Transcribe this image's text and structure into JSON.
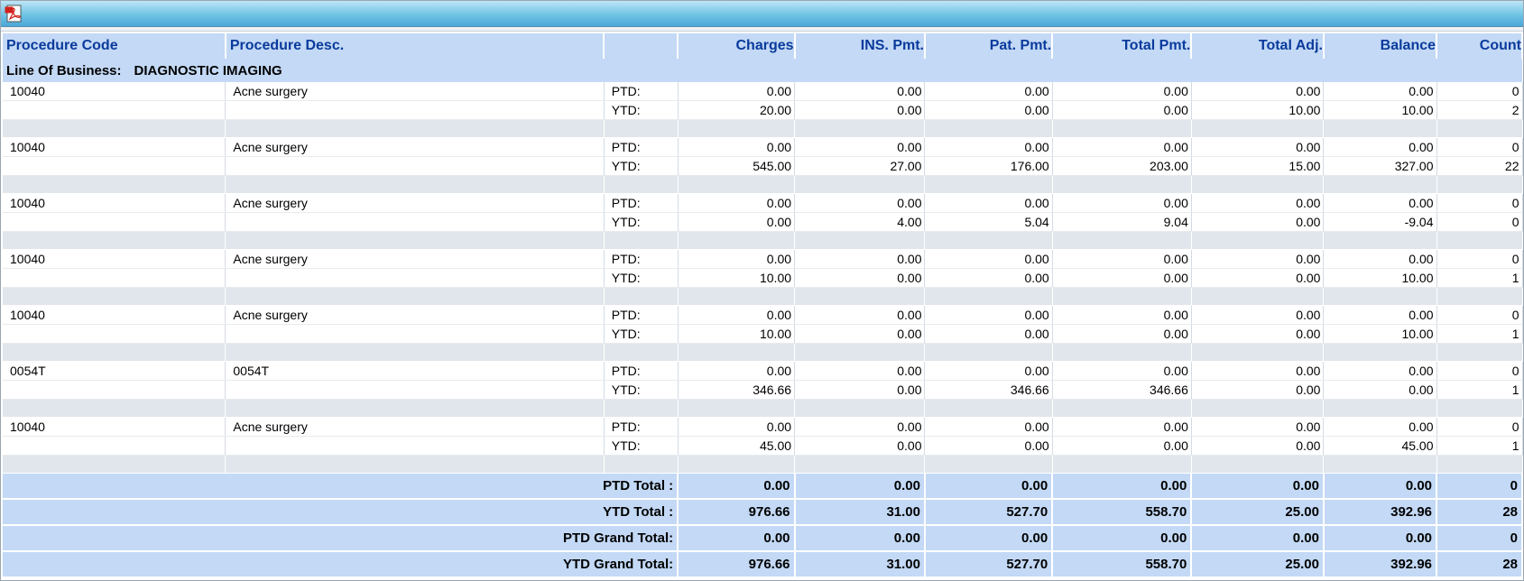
{
  "toolbar": {
    "pdf_icon": "pdf-icon"
  },
  "columns": [
    "Procedure Code",
    "Procedure Desc.",
    "",
    "Charges",
    "INS. Pmt.",
    "Pat. Pmt.",
    "Total Pmt.",
    "Total Adj.",
    "Balance",
    "Count"
  ],
  "line_of_business": {
    "label": "Line Of Business:",
    "value": "DIAGNOSTIC IMAGING"
  },
  "groups": [
    {
      "code": "10040",
      "desc": "Acne surgery",
      "ptd": {
        "label": "PTD:",
        "values": [
          "0.00",
          "0.00",
          "0.00",
          "0.00",
          "0.00",
          "0.00",
          "0"
        ]
      },
      "ytd": {
        "label": "YTD:",
        "values": [
          "20.00",
          "0.00",
          "0.00",
          "0.00",
          "10.00",
          "10.00",
          "2"
        ]
      }
    },
    {
      "code": "10040",
      "desc": "Acne surgery",
      "ptd": {
        "label": "PTD:",
        "values": [
          "0.00",
          "0.00",
          "0.00",
          "0.00",
          "0.00",
          "0.00",
          "0"
        ]
      },
      "ytd": {
        "label": "YTD:",
        "values": [
          "545.00",
          "27.00",
          "176.00",
          "203.00",
          "15.00",
          "327.00",
          "22"
        ]
      }
    },
    {
      "code": "10040",
      "desc": "Acne surgery",
      "ptd": {
        "label": "PTD:",
        "values": [
          "0.00",
          "0.00",
          "0.00",
          "0.00",
          "0.00",
          "0.00",
          "0"
        ]
      },
      "ytd": {
        "label": "YTD:",
        "values": [
          "0.00",
          "4.00",
          "5.04",
          "9.04",
          "0.00",
          "-9.04",
          "0"
        ]
      }
    },
    {
      "code": "10040",
      "desc": "Acne surgery",
      "ptd": {
        "label": "PTD:",
        "values": [
          "0.00",
          "0.00",
          "0.00",
          "0.00",
          "0.00",
          "0.00",
          "0"
        ]
      },
      "ytd": {
        "label": "YTD:",
        "values": [
          "10.00",
          "0.00",
          "0.00",
          "0.00",
          "0.00",
          "10.00",
          "1"
        ]
      }
    },
    {
      "code": "10040",
      "desc": "Acne surgery",
      "ptd": {
        "label": "PTD:",
        "values": [
          "0.00",
          "0.00",
          "0.00",
          "0.00",
          "0.00",
          "0.00",
          "0"
        ]
      },
      "ytd": {
        "label": "YTD:",
        "values": [
          "10.00",
          "0.00",
          "0.00",
          "0.00",
          "0.00",
          "10.00",
          "1"
        ]
      }
    },
    {
      "code": "0054T",
      "desc": "0054T",
      "ptd": {
        "label": "PTD:",
        "values": [
          "0.00",
          "0.00",
          "0.00",
          "0.00",
          "0.00",
          "0.00",
          "0"
        ]
      },
      "ytd": {
        "label": "YTD:",
        "values": [
          "346.66",
          "0.00",
          "346.66",
          "346.66",
          "0.00",
          "0.00",
          "1"
        ]
      }
    },
    {
      "code": "10040",
      "desc": "Acne surgery",
      "ptd": {
        "label": "PTD:",
        "values": [
          "0.00",
          "0.00",
          "0.00",
          "0.00",
          "0.00",
          "0.00",
          "0"
        ]
      },
      "ytd": {
        "label": "YTD:",
        "values": [
          "45.00",
          "0.00",
          "0.00",
          "0.00",
          "0.00",
          "45.00",
          "1"
        ]
      }
    }
  ],
  "totals": [
    {
      "label": "PTD Total :",
      "values": [
        "0.00",
        "0.00",
        "0.00",
        "0.00",
        "0.00",
        "0.00",
        "0"
      ]
    },
    {
      "label": "YTD Total :",
      "values": [
        "976.66",
        "31.00",
        "527.70",
        "558.70",
        "25.00",
        "392.96",
        "28"
      ]
    },
    {
      "label": "PTD Grand Total:",
      "values": [
        "0.00",
        "0.00",
        "0.00",
        "0.00",
        "0.00",
        "0.00",
        "0"
      ]
    },
    {
      "label": "YTD Grand Total:",
      "values": [
        "976.66",
        "31.00",
        "527.70",
        "558.70",
        "25.00",
        "392.96",
        "28"
      ]
    }
  ]
}
